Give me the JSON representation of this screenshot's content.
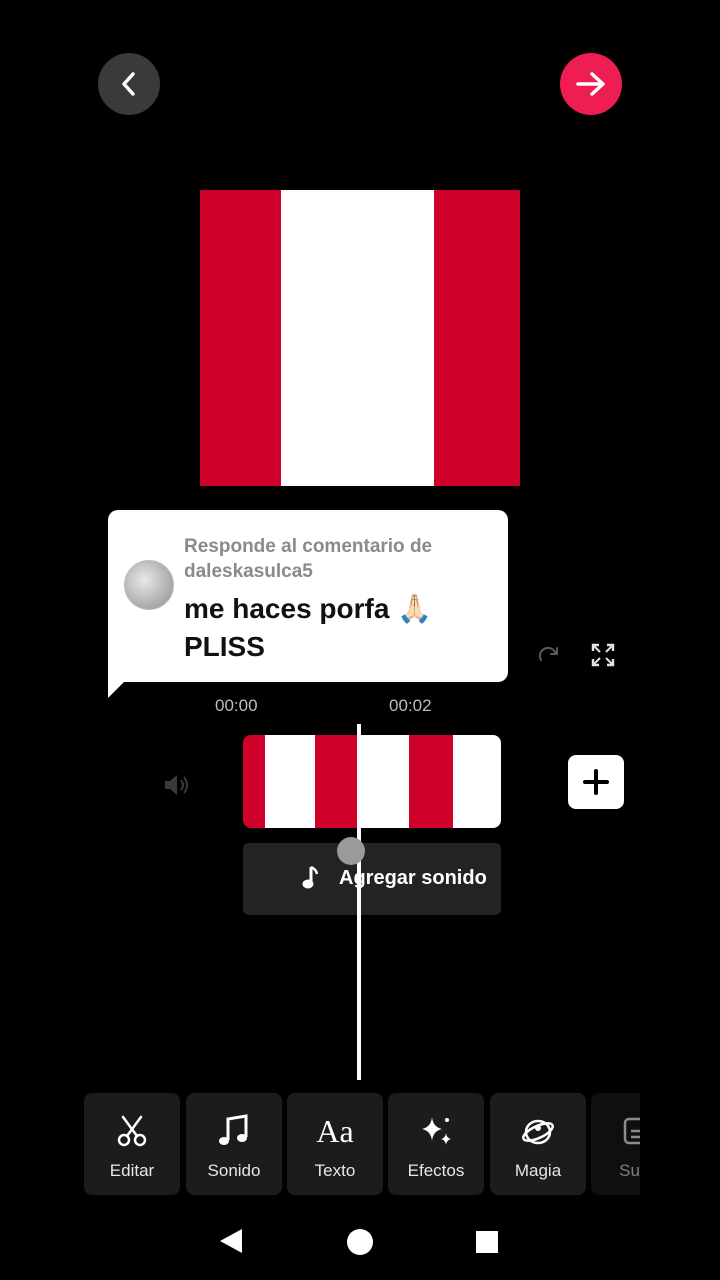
{
  "header": {
    "back_icon": "chevron-left-icon",
    "next_icon": "arrow-right-icon",
    "next_color": "#ee1d52"
  },
  "preview": {
    "flag_colors": [
      "#cf0029",
      "#ffffff",
      "#cf0029"
    ]
  },
  "reply_sticker": {
    "label": "Responde al comentario de daleskasulca5",
    "comment": "me haces porfa 🙏🏻 PLISS"
  },
  "timeline": {
    "time_start": "00:00",
    "time_mark": "00:02",
    "add_sound_label": "Agregar sonido"
  },
  "toolbar": {
    "items": [
      {
        "label": "Editar",
        "icon": "scissors-icon"
      },
      {
        "label": "Sonido",
        "icon": "music-note-icon"
      },
      {
        "label": "Texto",
        "icon": "text-icon"
      },
      {
        "label": "Efectos",
        "icon": "sparkles-icon"
      },
      {
        "label": "Magia",
        "icon": "magic-icon"
      },
      {
        "label": "Subtí",
        "icon": "captions-icon"
      }
    ]
  },
  "system_nav": {
    "back_icon": "nav-back-icon",
    "home_icon": "nav-home-icon",
    "recents_icon": "nav-recents-icon"
  }
}
